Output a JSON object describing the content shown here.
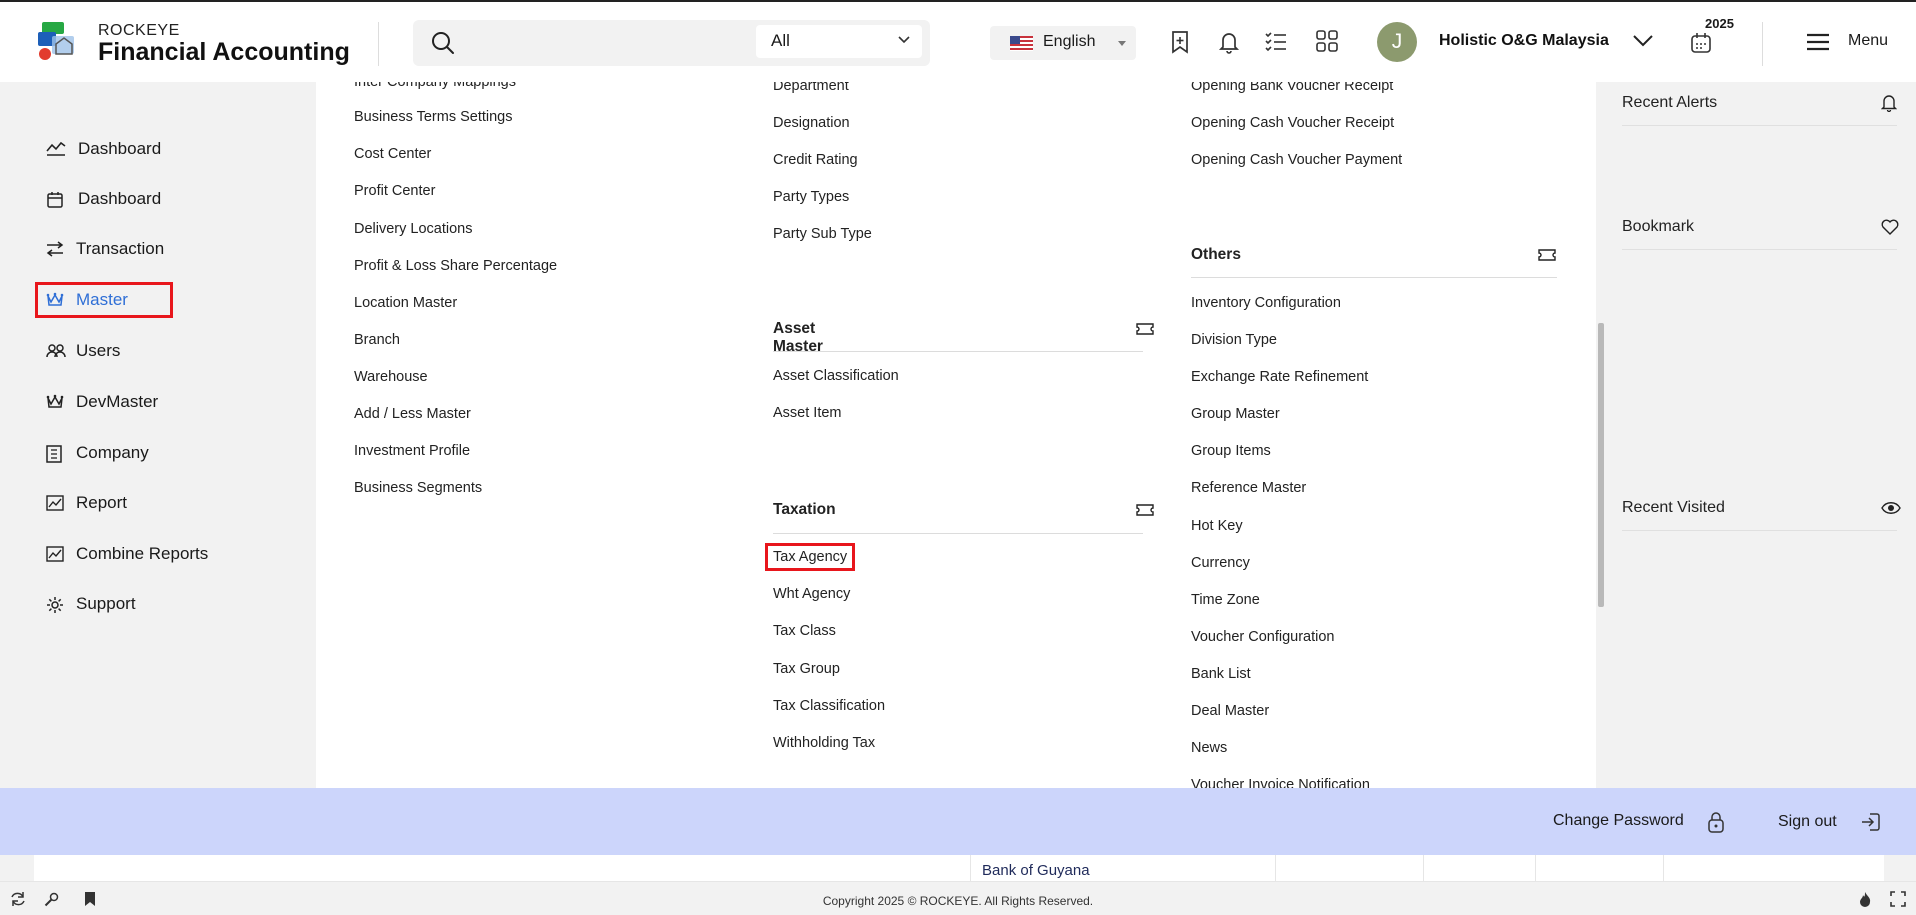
{
  "brand": {
    "top": "ROCKEYE",
    "main": "Financial Accounting"
  },
  "search": {
    "placeholder": "",
    "scope": "All"
  },
  "language": {
    "label": "English"
  },
  "user": {
    "initial": "J",
    "company": "Holistic O&G Malaysia",
    "year": "2025"
  },
  "menu": {
    "label": "Menu"
  },
  "sidebar": {
    "items": [
      {
        "label": "Dashboard",
        "icon": "chart-line-icon"
      },
      {
        "label": "Dashboard",
        "icon": "calendar-icon"
      },
      {
        "label": "Transaction",
        "icon": "swap-arrows-icon"
      },
      {
        "label": "Master",
        "icon": "crown-icon",
        "active": true
      },
      {
        "label": "Users",
        "icon": "users-icon"
      },
      {
        "label": "DevMaster",
        "icon": "crown-icon"
      },
      {
        "label": "Company",
        "icon": "building-icon"
      },
      {
        "label": "Report",
        "icon": "report-chart-icon"
      },
      {
        "label": "Combine Reports",
        "icon": "report-chart-icon"
      },
      {
        "label": "Support",
        "icon": "gear-icon"
      }
    ]
  },
  "columns": {
    "col1": [
      "Inter Company Mappings",
      "Business Terms Settings",
      "Cost Center",
      "Profit Center",
      "Delivery Locations",
      "Profit & Loss Share Percentage",
      "Location Master",
      "Branch",
      "Warehouse",
      "Add / Less Master",
      "Investment Profile",
      "Business Segments"
    ],
    "col2_top": [
      "Department",
      "Designation",
      "Credit Rating",
      "Party Types",
      "Party Sub Type"
    ],
    "asset_master": {
      "title": "Asset Master",
      "items": [
        "Asset Classification",
        "Asset Item"
      ]
    },
    "taxation": {
      "title": "Taxation",
      "items": [
        "Tax Agency",
        "Wht Agency",
        "Tax Class",
        "Tax Group",
        "Tax Classification",
        "Withholding Tax"
      ]
    },
    "col3_top": [
      "Opening Bank Voucher Receipt",
      "Opening Cash Voucher Receipt",
      "Opening Cash Voucher Payment"
    ],
    "others": {
      "title": "Others",
      "items": [
        "Inventory Configuration",
        "Division Type",
        "Exchange Rate Refinement",
        "Group Master",
        "Group Items",
        "Reference Master",
        "Hot Key",
        "Currency",
        "Time Zone",
        "Voucher Configuration",
        "Bank List",
        "Deal Master",
        "News",
        "Voucher Invoice Notification"
      ]
    }
  },
  "right_panel": {
    "alerts": "Recent Alerts",
    "bookmark": "Bookmark",
    "visited": "Recent Visited"
  },
  "band": {
    "change_password": "Change Password",
    "sign_out": "Sign out"
  },
  "under_text": "Bank of Guyana",
  "footer": {
    "copyright": "Copyright 2025 © ROCKEYE. All Rights Reserved."
  },
  "colors": {
    "accent": "#2f6fd6",
    "highlight": "#e8161c",
    "band": "#ccd5fb"
  }
}
